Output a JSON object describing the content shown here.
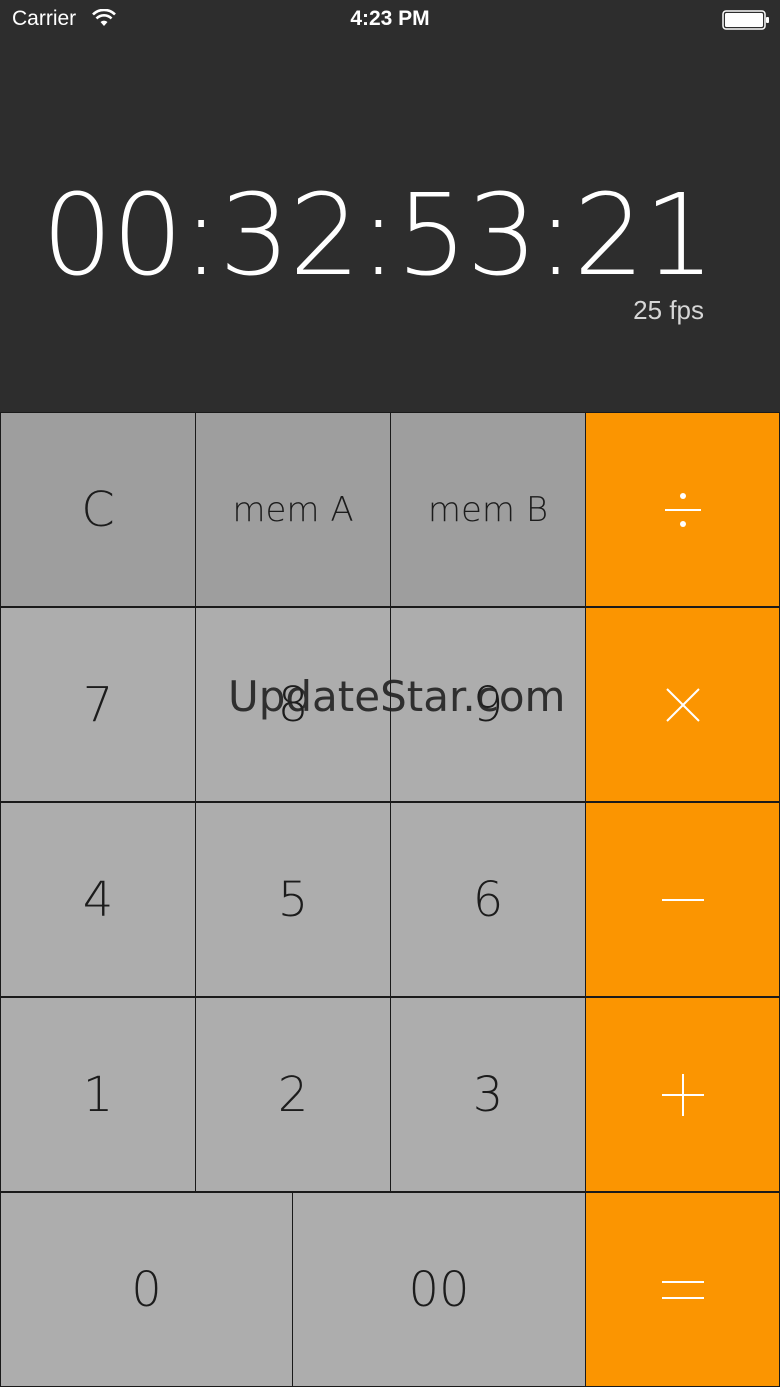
{
  "status_bar": {
    "carrier": "Carrier",
    "time": "4:23 PM"
  },
  "display": {
    "timecode": "00:32:53:21",
    "fps": "25 fps"
  },
  "keys": {
    "clear": "C",
    "mem_a": "mem A",
    "mem_b": "mem B",
    "seven": "7",
    "eight": "8",
    "nine": "9",
    "four": "4",
    "five": "5",
    "six": "6",
    "one": "1",
    "two": "2",
    "three": "3",
    "zero": "0",
    "double_zero": "00"
  },
  "operators": [
    "divide-icon",
    "multiply-icon",
    "minus-icon",
    "plus-icon",
    "equals-icon"
  ],
  "watermark": "UpdateStar.com",
  "colors": {
    "display_bg": "#2d2d2d",
    "key_gray": "#adadad",
    "key_dark": "#9e9e9e",
    "operator_orange": "#fb9501"
  }
}
